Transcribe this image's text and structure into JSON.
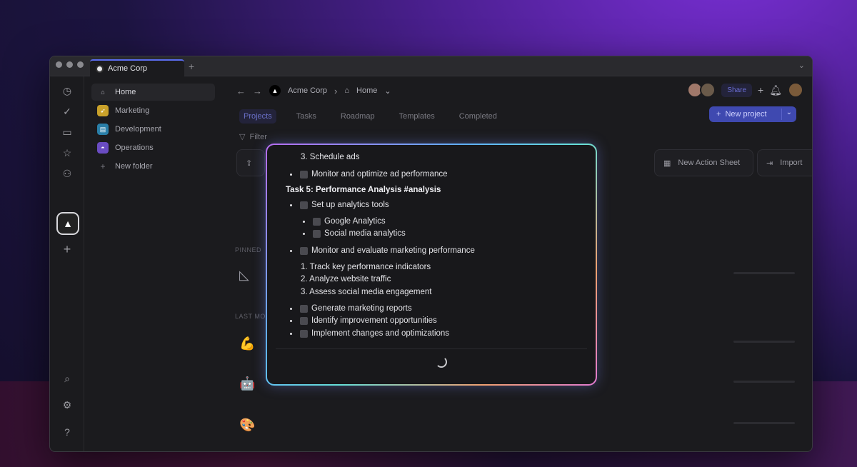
{
  "titlebar": {
    "tab_label": "Acme Corp"
  },
  "sidebar": {
    "items": [
      {
        "label": "Home",
        "icon": "home-icon",
        "color": "#26262a"
      },
      {
        "label": "Marketing",
        "icon": "rocket-icon",
        "color": "#c9a12a"
      },
      {
        "label": "Development",
        "icon": "code-icon",
        "color": "#2a7fa8"
      },
      {
        "label": "Operations",
        "icon": "gear-icon",
        "color": "#6a4cc2"
      },
      {
        "label": "New folder",
        "icon": "plus-icon",
        "color": ""
      }
    ]
  },
  "breadcrumb": {
    "org": "Acme Corp",
    "page": "Home"
  },
  "header": {
    "share_label": "Share"
  },
  "tabs": [
    {
      "label": "Projects",
      "active": true
    },
    {
      "label": "Tasks",
      "active": false
    },
    {
      "label": "Roadmap",
      "active": false
    },
    {
      "label": "Templates",
      "active": false
    },
    {
      "label": "Completed",
      "active": false
    }
  ],
  "actions": {
    "new_project": "New project",
    "filter": "Filter",
    "new_action_sheet": "New Action Sheet",
    "import": "Import"
  },
  "sections": {
    "pinned": "PINNED",
    "last_modified": "LAST MO"
  },
  "overlay": {
    "lines": [
      {
        "kind": "numbered",
        "text": "3. Schedule ads"
      },
      {
        "kind": "check",
        "text": "Monitor and optimize ad performance"
      },
      {
        "kind": "heading",
        "text": "Task 5: Performance Analysis #analysis"
      },
      {
        "kind": "check",
        "text": "Set up analytics tools"
      },
      {
        "kind": "subcheck",
        "text": "Google Analytics"
      },
      {
        "kind": "subcheck",
        "text": "Social media analytics"
      },
      {
        "kind": "check",
        "text": "Monitor and evaluate marketing performance"
      },
      {
        "kind": "numbered",
        "text": "1. Track key performance indicators"
      },
      {
        "kind": "numbered",
        "text": "2. Analyze website traffic"
      },
      {
        "kind": "numbered",
        "text": "3. Assess social media engagement"
      },
      {
        "kind": "check",
        "text": "Generate marketing reports"
      },
      {
        "kind": "check",
        "text": "Identify improvement opportunities"
      },
      {
        "kind": "check",
        "text": "Implement changes and optimizations"
      }
    ]
  },
  "colors": {
    "accent": "#3f49b0",
    "active_tab": "#6a70c8"
  }
}
